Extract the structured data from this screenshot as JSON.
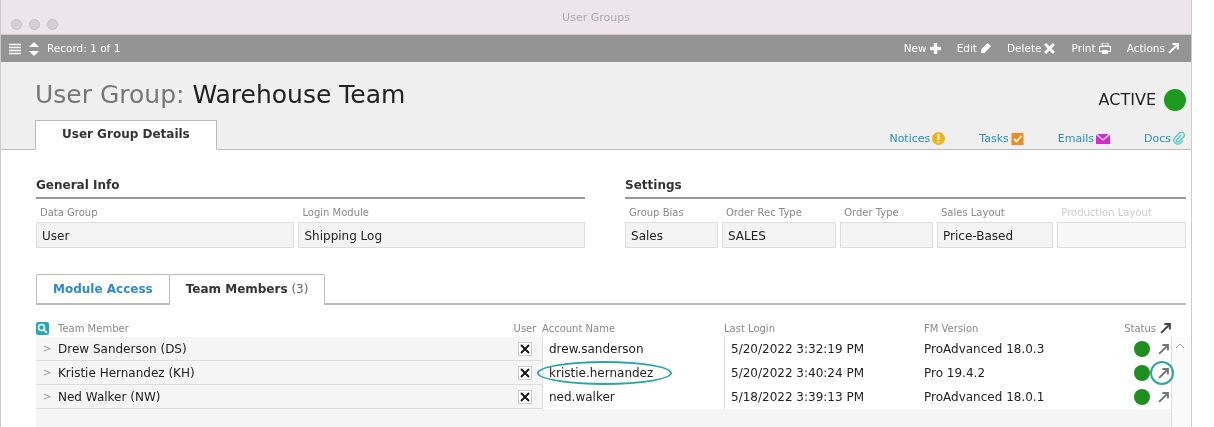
{
  "window": {
    "title": "User Groups"
  },
  "toolbar": {
    "record": "Record: 1 of 1",
    "actions": [
      {
        "label": "New",
        "kind": "new"
      },
      {
        "label": "Edit",
        "kind": "edit"
      },
      {
        "label": "Delete",
        "kind": "delete"
      },
      {
        "label": "Print",
        "kind": "print"
      },
      {
        "label": "Actions",
        "kind": "actions"
      }
    ]
  },
  "header": {
    "prefix": "User Group:",
    "name": "Warehouse Team",
    "status": "ACTIVE",
    "color": "#1e9a1e"
  },
  "tabs": [
    {
      "label": "User Group Details",
      "selected": true
    }
  ],
  "links": [
    {
      "label": "Notices",
      "kind": "notices"
    },
    {
      "label": "Tasks",
      "kind": "tasks"
    },
    {
      "label": "Emails",
      "kind": "emails"
    },
    {
      "label": "Docs",
      "kind": "docs"
    }
  ],
  "sections": [
    {
      "title": "General Info",
      "fields": [
        {
          "label": "Data Group",
          "value": "User",
          "disabled": false
        },
        {
          "label": "Login Module",
          "value": "Shipping Log",
          "disabled": false
        }
      ]
    },
    {
      "title": "Settings",
      "fields": [
        {
          "label": "Group Bias",
          "value": "Sales",
          "disabled": false
        },
        {
          "label": "Order Rec Type",
          "value": "SALES",
          "disabled": false
        },
        {
          "label": "Order Type",
          "disabled": false
        },
        {
          "label": "Sales Layout",
          "value": "Price-Based",
          "disabled": false
        },
        {
          "label": "Production Layout",
          "disabled": true
        }
      ]
    }
  ],
  "subtabs": [
    {
      "label": "Module Access",
      "selected": false
    },
    {
      "label": "Team Members",
      "count": "(3)",
      "selected": true
    }
  ],
  "table": {
    "columns": [
      "Team Member",
      "User",
      "Account Name",
      "Last Login",
      "FM Version",
      "Status"
    ],
    "rows": [
      {
        "expander": ">",
        "member": "Drew Sanderson  (DS)",
        "user": true,
        "account": "drew.sanderson",
        "last_login": "5/20/2022 3:32:19 PM",
        "fm_version": "ProAdvanced 18.0.3",
        "color": "#1e8f1e",
        "account_circled": false,
        "action_circled": false
      },
      {
        "expander": ">",
        "member": "Kristie Hernandez  (KH)",
        "user": true,
        "account": "kristie.hernandez",
        "last_login": "5/20/2022 3:40:24 PM",
        "fm_version": "Pro 19.4.2",
        "color": "#1e8f1e",
        "account_circled": true,
        "action_circled": true
      },
      {
        "expander": ">",
        "member": "Ned Walker  (NW)",
        "user": true,
        "account": "ned.walker",
        "last_login": "5/18/2022 3:39:13 PM",
        "fm_version": "ProAdvanced 18.0.1",
        "color": "#1e8f1e",
        "account_circled": false,
        "action_circled": false
      }
    ]
  }
}
